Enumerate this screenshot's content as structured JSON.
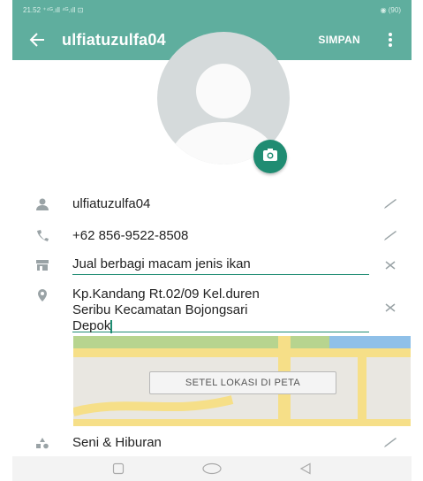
{
  "status_bar": {
    "left": "21.52 ⁺⁴ᴳ.ıll ⁴ᴳ.ıll ⊡",
    "right": "◉ (90)"
  },
  "app_bar": {
    "title": "ulfiatuzulfa04",
    "save_label": "SIMPAN",
    "icons": [
      "back-arrow-icon",
      "more-vert-icon"
    ]
  },
  "profile": {
    "icons": [
      "avatar-placeholder",
      "camera-icon"
    ]
  },
  "fields": {
    "name": {
      "value": "ulfiatuzulfa04",
      "icon": "person-icon",
      "action_icon": "edit-pencil-icon"
    },
    "phone": {
      "value": "+62 856-9522-8508",
      "icon": "phone-icon",
      "action_icon": "edit-pencil-icon"
    },
    "description": {
      "value": "Jual berbagi macam jenis ikan",
      "icon": "store-icon",
      "action_icon": "clear-icon"
    },
    "address": {
      "line1": "Kp.Kandang Rt.02/09 Kel.duren",
      "line2": "Seribu Kecamatan Bojongsari",
      "line3": "Depok",
      "icon": "location-pin-icon",
      "action_icon": "clear-icon"
    },
    "category": {
      "value": "Seni & Hiburan",
      "icon": "category-shapes-icon",
      "action_icon": "edit-pencil-icon"
    }
  },
  "map": {
    "button_label": "SETEL LOKASI DI PETA"
  },
  "nav_bar": {
    "icons": [
      "recents-square-icon",
      "home-circle-icon",
      "back-triangle-icon"
    ]
  },
  "colors": {
    "primary": "#5fae9e",
    "accent": "#1f8c72",
    "icon_gray": "#9aa3a6"
  }
}
